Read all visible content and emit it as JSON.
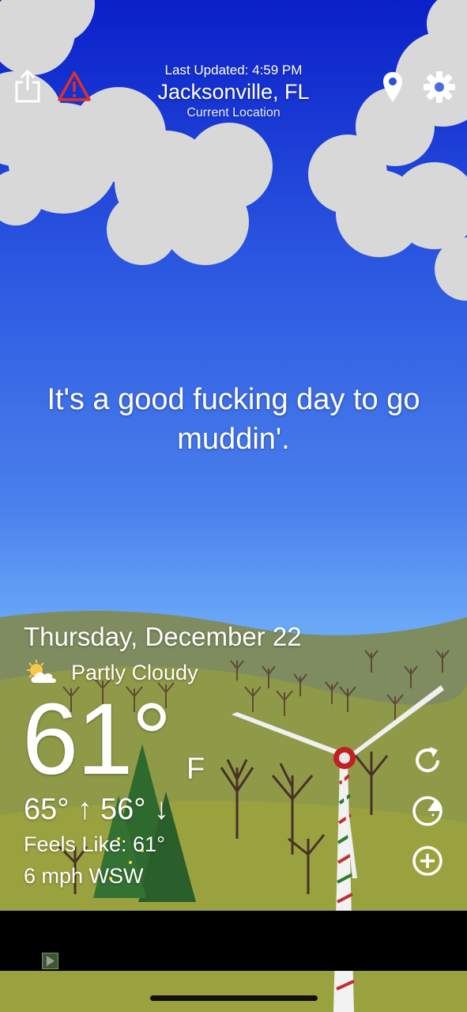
{
  "header": {
    "last_updated": "Last Updated: 4:59 PM",
    "city": "Jacksonville, FL",
    "location_label": "Current Location"
  },
  "icons": {
    "share": "share-icon",
    "alert": "warning-triangle-icon",
    "location": "map-pin-icon",
    "settings": "gear-icon",
    "refresh": "refresh-icon",
    "radar": "radar-icon",
    "add": "plus-circle-icon"
  },
  "message": "It's a good fucking day to go muddin'.",
  "forecast": {
    "date": "Thursday, December 22",
    "condition": "Partly Cloudy",
    "condition_icon": "partly-cloudy-icon",
    "temperature": "61°",
    "unit": "F",
    "high": "65° ↑",
    "low": "56° ↓",
    "feels_like": "Feels Like: 61°",
    "wind": "6 mph WSW"
  },
  "colors": {
    "sky_top": "#0a1fc8",
    "sky_bottom": "#6aa8f8",
    "alert_red": "#e0302a",
    "hill_back": "#7a8a5a",
    "hill_front": "#8a9a40"
  }
}
